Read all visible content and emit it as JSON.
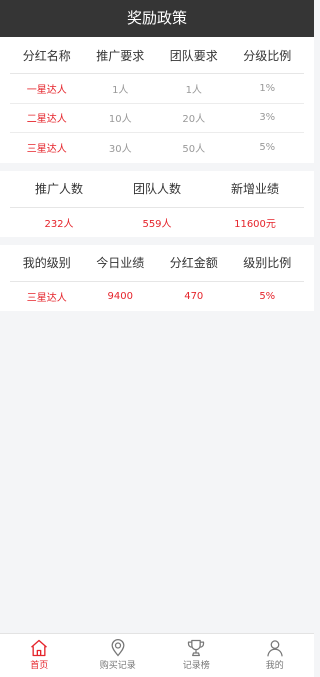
{
  "header": {
    "title": "奖励政策"
  },
  "policy": {
    "columns": [
      "分红名称",
      "推广要求",
      "团队要求",
      "分级比例"
    ],
    "rows": [
      {
        "name": "一星达人",
        "promote": "1人",
        "team": "1人",
        "ratio": "1%"
      },
      {
        "name": "二星达人",
        "promote": "10人",
        "team": "20人",
        "ratio": "3%"
      },
      {
        "name": "三星达人",
        "promote": "30人",
        "team": "50人",
        "ratio": "5%"
      }
    ]
  },
  "stats": {
    "labels": [
      "推广人数",
      "团队人数",
      "新增业绩"
    ],
    "values": [
      "232人",
      "559人",
      "11600元"
    ]
  },
  "mine": {
    "labels": [
      "我的级别",
      "今日业绩",
      "分红金额",
      "级别比例"
    ],
    "values": [
      "三星达人",
      "9400",
      "470",
      "5%"
    ]
  },
  "tabbar": {
    "items": [
      {
        "label": "首页",
        "icon": "home-icon",
        "active": true
      },
      {
        "label": "购买记录",
        "icon": "location-pin-icon",
        "active": false
      },
      {
        "label": "记录榜",
        "icon": "trophy-icon",
        "active": false
      },
      {
        "label": "我的",
        "icon": "user-icon",
        "active": false
      }
    ],
    "active_color": "#e5242b"
  }
}
